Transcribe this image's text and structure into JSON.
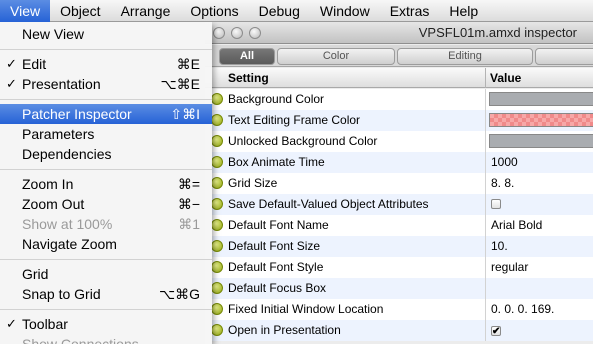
{
  "menubar": {
    "items": [
      "View",
      "Object",
      "Arrange",
      "Options",
      "Debug",
      "Window",
      "Extras",
      "Help"
    ],
    "active": "View"
  },
  "window": {
    "title": "VPSFL01m.amxd inspector",
    "tabs": [
      "All",
      "Color",
      "Editing",
      ""
    ],
    "selected_tab": "All",
    "columns": {
      "setting": "Setting",
      "value": "Value"
    },
    "rows": [
      {
        "setting": "Background Color",
        "value": "",
        "kind": "swatch",
        "color": "#a9acb0"
      },
      {
        "setting": "Text Editing Frame Color",
        "value": "",
        "kind": "checker",
        "color": "#f08a8a"
      },
      {
        "setting": "Unlocked Background Color",
        "value": "",
        "kind": "swatch",
        "color": "#a9acb0"
      },
      {
        "setting": "Box Animate Time",
        "value": "1000",
        "kind": "text"
      },
      {
        "setting": "Grid Size",
        "value": "8. 8.",
        "kind": "text"
      },
      {
        "setting": "Save Default-Valued Object Attributes",
        "value": "",
        "kind": "checkbox",
        "checked": false
      },
      {
        "setting": "Default Font Name",
        "value": "Arial Bold",
        "kind": "text"
      },
      {
        "setting": "Default Font Size",
        "value": "10.",
        "kind": "text"
      },
      {
        "setting": "Default Font Style",
        "value": "regular",
        "kind": "text"
      },
      {
        "setting": "Default Focus Box",
        "value": "",
        "kind": "text"
      },
      {
        "setting": "Fixed Initial Window Location",
        "value": "0. 0. 0. 169.",
        "kind": "text"
      },
      {
        "setting": "Open in Presentation",
        "value": "",
        "kind": "checkbox",
        "checked": true
      }
    ]
  },
  "view_menu": {
    "items": [
      {
        "type": "item",
        "label": "New View",
        "shortcut": "",
        "checked": false,
        "disabled": false,
        "highlight": false
      },
      {
        "type": "sep"
      },
      {
        "type": "item",
        "label": "Edit",
        "shortcut": "⌘E",
        "checked": true,
        "disabled": false,
        "highlight": false
      },
      {
        "type": "item",
        "label": "Presentation",
        "shortcut": "⌥⌘E",
        "checked": true,
        "disabled": false,
        "highlight": false
      },
      {
        "type": "sep"
      },
      {
        "type": "item",
        "label": "Patcher Inspector",
        "shortcut": "⇧⌘I",
        "checked": false,
        "disabled": false,
        "highlight": true
      },
      {
        "type": "item",
        "label": "Parameters",
        "shortcut": "",
        "checked": false,
        "disabled": false,
        "highlight": false
      },
      {
        "type": "item",
        "label": "Dependencies",
        "shortcut": "",
        "checked": false,
        "disabled": false,
        "highlight": false
      },
      {
        "type": "sep"
      },
      {
        "type": "item",
        "label": "Zoom In",
        "shortcut": "⌘=",
        "checked": false,
        "disabled": false,
        "highlight": false
      },
      {
        "type": "item",
        "label": "Zoom Out",
        "shortcut": "⌘−",
        "checked": false,
        "disabled": false,
        "highlight": false
      },
      {
        "type": "item",
        "label": "Show at 100%",
        "shortcut": "⌘1",
        "checked": false,
        "disabled": true,
        "highlight": false
      },
      {
        "type": "item",
        "label": "Navigate Zoom",
        "shortcut": "",
        "checked": false,
        "disabled": false,
        "highlight": false
      },
      {
        "type": "sep"
      },
      {
        "type": "item",
        "label": "Grid",
        "shortcut": "",
        "checked": false,
        "disabled": false,
        "highlight": false
      },
      {
        "type": "item",
        "label": "Snap to Grid",
        "shortcut": "⌥⌘G",
        "checked": false,
        "disabled": false,
        "highlight": false
      },
      {
        "type": "sep"
      },
      {
        "type": "item",
        "label": "Toolbar",
        "shortcut": "",
        "checked": true,
        "disabled": false,
        "highlight": false
      },
      {
        "type": "item",
        "label": "Show Connections",
        "shortcut": "",
        "checked": false,
        "disabled": true,
        "highlight": false
      }
    ]
  }
}
